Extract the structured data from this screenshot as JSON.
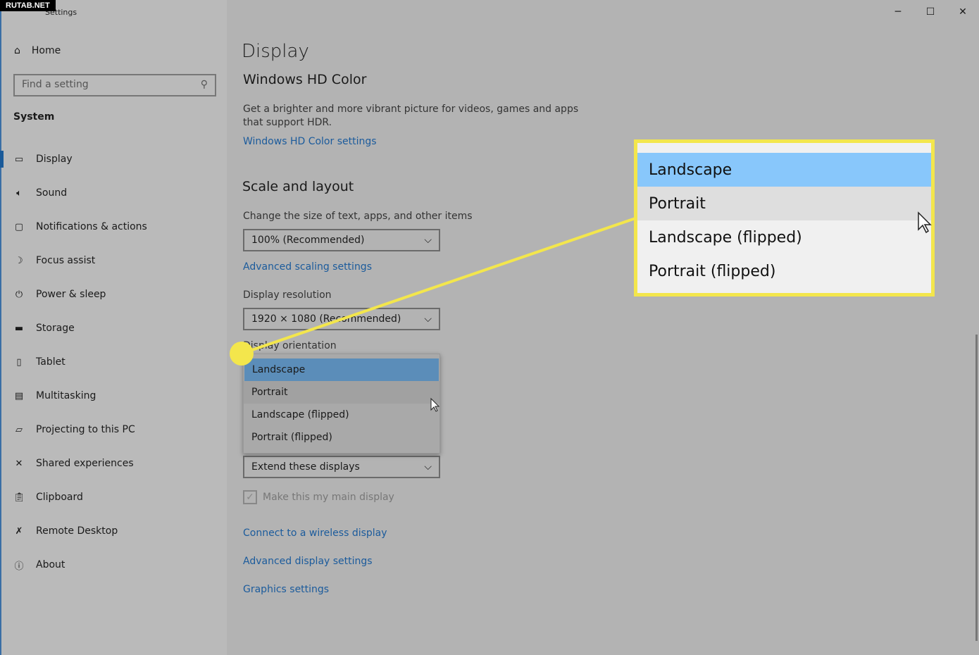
{
  "watermark": "RUTAB.NET",
  "window": {
    "title": "Settings",
    "back_icon": "back-arrow-icon",
    "minimize": "─",
    "maximize": "☐",
    "close": "✕"
  },
  "sidebar": {
    "home": "Home",
    "search_placeholder": "Find a setting",
    "section": "System",
    "items": [
      {
        "label": "Display",
        "icon": "monitor-icon"
      },
      {
        "label": "Sound",
        "icon": "speaker-icon"
      },
      {
        "label": "Notifications & actions",
        "icon": "notification-icon"
      },
      {
        "label": "Focus assist",
        "icon": "moon-icon"
      },
      {
        "label": "Power & sleep",
        "icon": "power-icon"
      },
      {
        "label": "Storage",
        "icon": "storage-icon"
      },
      {
        "label": "Tablet",
        "icon": "tablet-icon"
      },
      {
        "label": "Multitasking",
        "icon": "multitasking-icon"
      },
      {
        "label": "Projecting to this PC",
        "icon": "projector-icon"
      },
      {
        "label": "Shared experiences",
        "icon": "shared-icon"
      },
      {
        "label": "Clipboard",
        "icon": "clipboard-icon"
      },
      {
        "label": "Remote Desktop",
        "icon": "remote-icon"
      },
      {
        "label": "About",
        "icon": "info-icon"
      }
    ]
  },
  "main": {
    "title": "Display",
    "hdr": {
      "heading": "Windows HD Color",
      "desc1": "Get a brighter and more vibrant picture for videos, games and apps",
      "desc2": "that support HDR.",
      "link": "Windows HD Color settings"
    },
    "scale": {
      "heading": "Scale and layout",
      "size_label": "Change the size of text, apps, and other items",
      "size_value": "100% (Recommended)",
      "adv_link": "Advanced scaling settings",
      "res_label": "Display resolution",
      "res_value": "1920 × 1080 (Recommended)",
      "orient_label": "Display orientation"
    },
    "orientation_options": [
      "Landscape",
      "Portrait",
      "Landscape (flipped)",
      "Portrait (flipped)"
    ],
    "selected": "Landscape",
    "hovered": "Portrait",
    "multi_value": "Extend these displays",
    "main_display": "Make this my main display",
    "main_display_checked": true,
    "links": [
      "Connect to a wireless display",
      "Advanced display settings",
      "Graphics settings"
    ]
  },
  "colors": {
    "accent": "#1b5b9c",
    "highlight": "#88c7fb",
    "callout": "#f3e64c"
  }
}
